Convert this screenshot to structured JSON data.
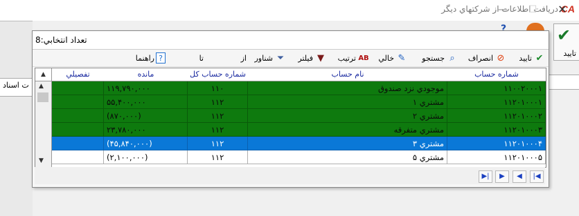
{
  "window": {
    "title": "دريافت اطلاعات از شرکتهاي ديگر",
    "logo": "CA"
  },
  "background": {
    "approve_label": "تاييد",
    "tail_text": "ت اسناد"
  },
  "dialog": {
    "title": "تعداد انتخابي:8",
    "toolbar": {
      "approve": "تاييد",
      "cancel": "انصراف",
      "search": "جستجو",
      "empty": "خالي",
      "sort": "ترتيب",
      "filter": "فيلتر",
      "float": "شناور",
      "from": "از",
      "to": "تا",
      "help": "راهنما"
    },
    "columns": {
      "account_no": "شماره حساب",
      "account_name": "نام حساب",
      "total_account_no": "شماره حساب کل",
      "balance": "مانده",
      "detail": "تفصيلي"
    },
    "rows": [
      {
        "account_no": "۱۱۰۰۲۰۰۰۱",
        "account_name": "موجودي نزد صندوق",
        "total": "۱۱۰",
        "balance": "۱۱۹,۷۹۰,۰۰۰",
        "detail": ""
      },
      {
        "account_no": "۱۱۲۰۱۰۰۰۱",
        "account_name": "مشتري ۱",
        "total": "۱۱۲",
        "balance": "۵۵,۴۰۰,۰۰۰",
        "detail": ""
      },
      {
        "account_no": "۱۱۲۰۱۰۰۰۲",
        "account_name": "مشتري ۲",
        "total": "۱۱۲",
        "balance": "(۸۷۰,۰۰۰)",
        "detail": ""
      },
      {
        "account_no": "۱۱۲۰۱۰۰۰۳",
        "account_name": "مشتري متفرقه",
        "total": "۱۱۲",
        "balance": "۲۳,۷۸۰,۰۰۰",
        "detail": ""
      },
      {
        "account_no": "۱۱۲۰۱۰۰۰۴",
        "account_name": "مشتري ۳",
        "total": "۱۱۲",
        "balance": "(۴۵,۸۴۰,۰۰۰)",
        "detail": ""
      },
      {
        "account_no": "۱۱۲۰۱۰۰۰۵",
        "account_name": "مشتري ۵",
        "total": "۱۱۲",
        "balance": "(۲,۱۰۰,۰۰۰)",
        "detail": ""
      }
    ],
    "row_states": [
      "checked",
      "checked",
      "checked",
      "checked",
      "selected",
      "normal"
    ],
    "colors": {
      "checked": "#0e7a0e",
      "selected": "#0a78d7"
    },
    "nav": {
      "first": "first-record",
      "prev": "prev-record",
      "next": "next-record",
      "last": "last-record"
    }
  }
}
